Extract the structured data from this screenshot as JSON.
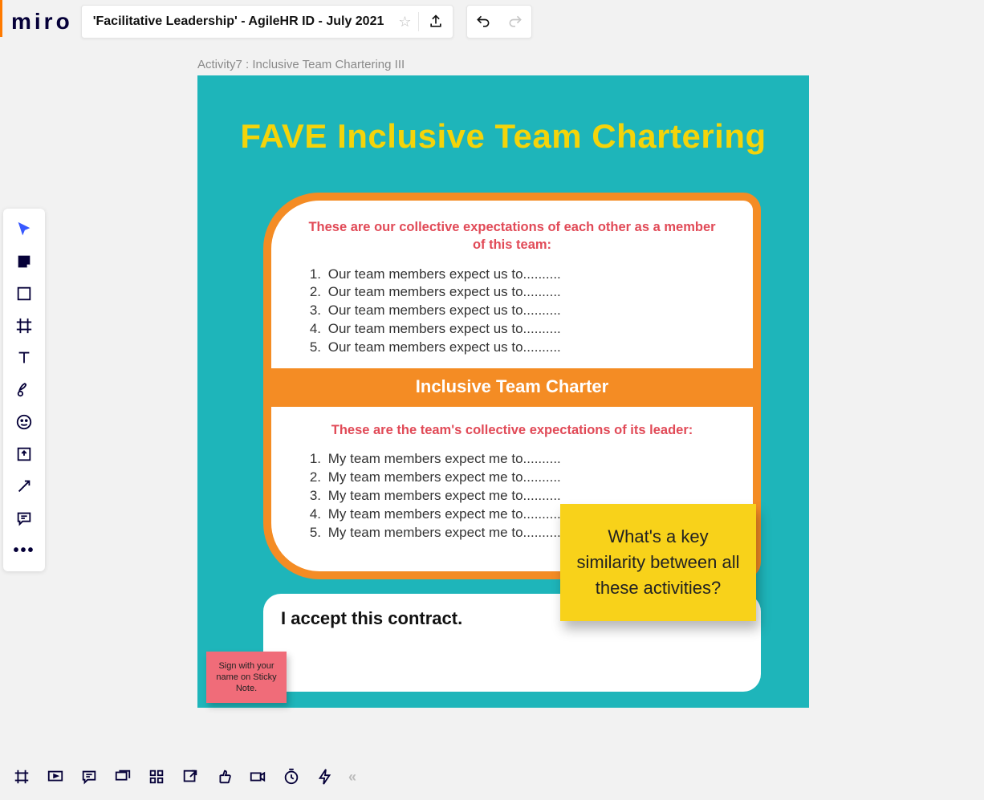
{
  "header": {
    "logo": "miro",
    "board_title": "'Facilitative Leadership' - AgileHR ID - July 2021"
  },
  "side_tools": {
    "select": "select-tool",
    "sticky": "sticky-note-tool",
    "shape": "shape-tool",
    "frame": "frame-tool",
    "text": "text-tool",
    "pen": "pen-tool",
    "emoji": "emoji-tool",
    "upload": "upload-tool",
    "connector": "connector-tool",
    "comment": "comment-tool",
    "more": "•••"
  },
  "bottom": {
    "collapse": "«"
  },
  "canvas": {
    "frame_label": "Activity7 : Inclusive Team Chartering III",
    "frame_title": "FAVE Inclusive Team Chartering",
    "card_top_heading": "These are our collective expectations of each other as a member of this team:",
    "team_expect": [
      "Our team members expect us to..........",
      "Our team members expect us to..........",
      "Our team members expect us to..........",
      "Our team members expect us to..........",
      "Our team members expect us to.........."
    ],
    "band_label": "Inclusive Team Charter",
    "card_bottom_heading": "These are the team's collective expectations of its leader:",
    "leader_expect": [
      "My team members expect me to..........",
      "My team members expect me to..........",
      "My team members expect me to..........",
      "My team members expect me to..........",
      "My team members expect me to.........."
    ],
    "accept_text": "I accept this contract.",
    "yellow_sticky": "What's a key similarity between all these activities?",
    "pink_sticky": "Sign with your name on Sticky Note."
  }
}
